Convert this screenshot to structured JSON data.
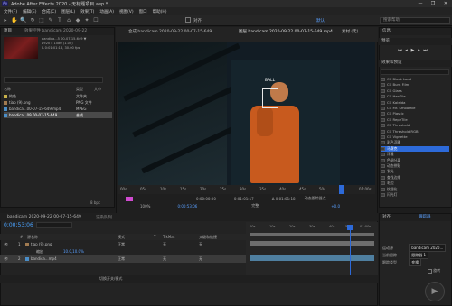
{
  "title_bar": {
    "app_title": "Adobe After Effects 2020 - 无标题项目.aep *",
    "minimize": "—",
    "maximize": "❐",
    "close": "✕"
  },
  "menu": [
    "文件(F)",
    "编辑(E)",
    "合成(C)",
    "图层(L)",
    "效果(T)",
    "动画(A)",
    "视图(V)",
    "窗口",
    "帮助(H)"
  ],
  "toolbar": {
    "tools": [
      "▸",
      "✋",
      "🔍",
      "↻",
      "⬚",
      "✎",
      "T",
      "⌂",
      "◆",
      "✦",
      "☐"
    ],
    "snap_label": "对齐",
    "workspace": "默认",
    "search_placeholder": "搜索帮助"
  },
  "project": {
    "tab": "项目",
    "tab_extra": "效果控件 bandicam 2020-09-22",
    "thumb_name": "bandica...5 00-07-15-649 ▼",
    "thumb_info_1": "1920 x 1080 (1.00)",
    "thumb_info_2": "Δ 0:01:01:16, 30.00 fps",
    "columns": [
      "名称",
      "类型",
      "大小"
    ],
    "rows": [
      {
        "name": "纯色",
        "color": "#c8b14a",
        "type": "文件夹",
        "size": ""
      },
      {
        "name": "tiap (9).png",
        "color": "#a07a50",
        "type": "PNG 文件",
        "size": ""
      },
      {
        "name": "bandica...00-07-15-649.mp4",
        "color": "#4a8ec8",
        "type": "MPEG",
        "size": ""
      },
      {
        "name": "bandica...09 00-07-15-649",
        "color": "#4a8ec8",
        "type": "合成",
        "size": ""
      }
    ],
    "footer": "8 bpc"
  },
  "viewer": {
    "tab_composition": "合成 bandicam 2020-09-22 00-07-15-649",
    "tab_layer": "图层 bandicam 2020-09-22 00-07-15-649.mp4",
    "tab_footage": "素材 (无)",
    "track_label": "BALL",
    "ruler_labels": [
      "00s",
      "05s",
      "10s",
      "15s",
      "20s",
      "25s",
      "30s",
      "35s",
      "40s",
      "45s",
      "50s",
      "55s",
      "01:00s"
    ],
    "ctrl_zoom": "100%",
    "ctrl_time": "0:00:53:06",
    "ctrl_res": "完整",
    "ctrl_in": "0:00:00:00",
    "ctrl_out": "0:01:01:17",
    "ctrl_duration": "Δ 0:01:01:18",
    "ctrl_view": "动态跟踪器点",
    "ctrl_offset": "+0.0"
  },
  "right_panel": {
    "info_tab": "信息",
    "preview_tab": "预览",
    "effects_tab": "效果和预设",
    "effects_search": "",
    "effects": [
      "CC Block Load",
      "CC Burn Film",
      "CC Glass",
      "CC HexTile",
      "CC Kaleida",
      "CC Mr. Smoothie",
      "CC Plastic",
      "CC RepeTile",
      "CC Threshold",
      "CC Threshold RGB",
      "CC Vignette",
      "彩色浮雕",
      "马赛克",
      "浮雕",
      "色调分离",
      "动态拼贴",
      "发光",
      "查找边缘",
      "毛边",
      "纹理化",
      "闪光灯"
    ],
    "selected_effect": "马赛克"
  },
  "timeline": {
    "tab_comp": "bandicam 2020-09-22 00-07-15-649",
    "tab_render": "渲染队列",
    "timecode": "0;00;53;06",
    "col_headers": [
      "#",
      "源名称",
      "模式",
      "T",
      "TrkMat",
      "父级和链接"
    ],
    "layers": [
      {
        "num": "1",
        "name": "tiap (9).png",
        "mode": "正常",
        "trkmat": "无",
        "parent": "无",
        "color": "#a07a50"
      },
      {
        "num": "",
        "name": "缩放",
        "mode": "",
        "trkmat": "",
        "parent": "",
        "color": "#666666"
      },
      {
        "num": "2",
        "name": "bandica...mp4",
        "mode": "正常",
        "trkmat": "无",
        "parent": "无",
        "color": "#4a8ec8"
      }
    ],
    "scale_value": "10.0,10.0%",
    "ruler_labels": [
      "00s",
      "10s",
      "20s",
      "30s",
      "40s",
      "50s",
      "01:00s"
    ],
    "bottom_label": "切换开关/模式"
  },
  "paragraph_panel": {
    "tab_align": "对齐",
    "tab_tracker": "跟踪器",
    "motion_source_label": "运动源",
    "motion_source_value": "bandicam 2020...",
    "current_track_label": "当前跟踪",
    "current_track_value": "跟踪器 1",
    "track_type_label": "跟踪类型",
    "track_type_value": "变换",
    "checkbox_label": "旋转",
    "apply_label": "应用"
  }
}
